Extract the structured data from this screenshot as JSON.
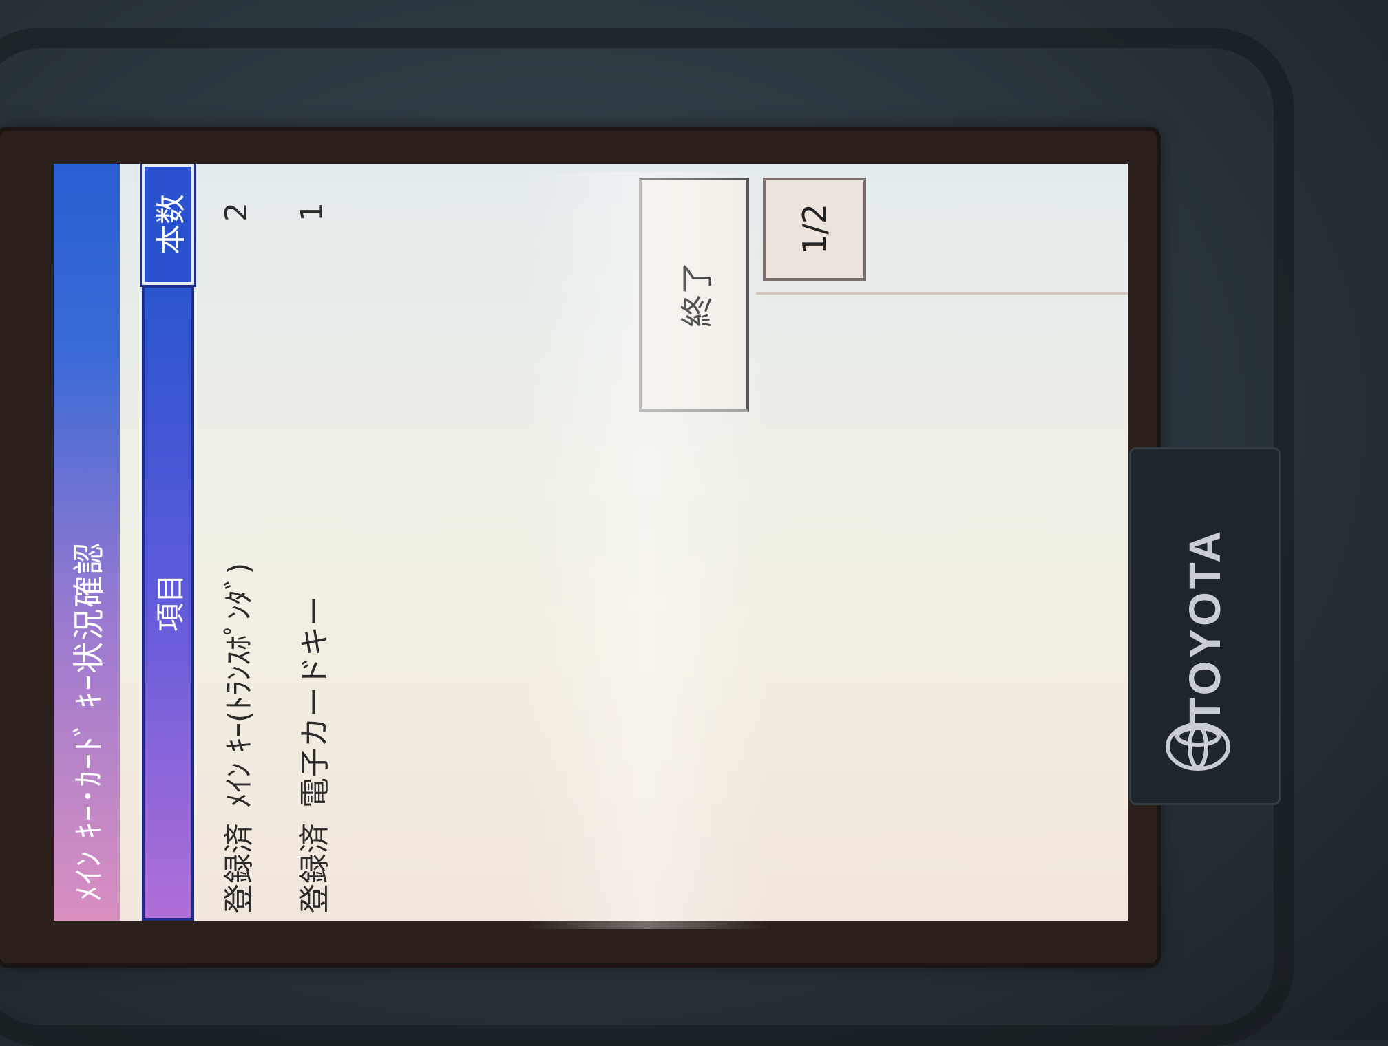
{
  "screen": {
    "title": "ﾒｲﾝ ｷｰ･ｶｰﾄﾞ ｷｰ状況確認",
    "columns": {
      "item": "項目",
      "count": "本数"
    },
    "rows": [
      {
        "status": "登録済",
        "label": "ﾒｲﾝ ｷｰ(ﾄﾗﾝｽﾎﾟﾝﾀﾞ)",
        "count": "2"
      },
      {
        "status": "登録済",
        "label": "電子カードキー",
        "count": "1"
      }
    ],
    "end_button_label": "終了",
    "page_indicator": "1/2"
  },
  "brand": {
    "name": "TOYOTA",
    "logo_icon": "toyota-logo-icon"
  },
  "colors": {
    "title_bar_start": "#d98fc0",
    "title_bar_end": "#2a5fd4",
    "header_blue": "#2a52cf",
    "screen_background": "#f3eee2"
  }
}
